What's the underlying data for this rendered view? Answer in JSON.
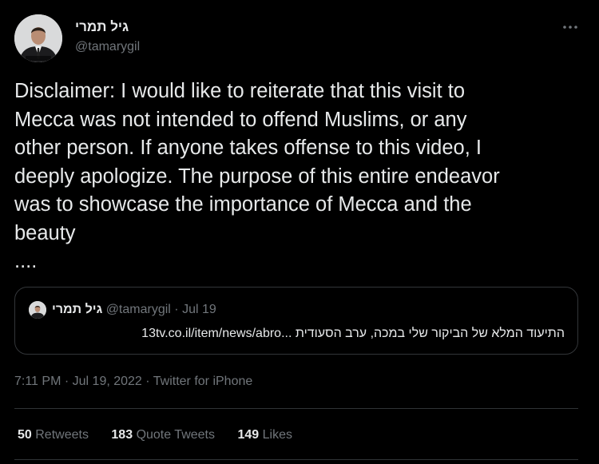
{
  "author": {
    "display_name": "גיל תמרי",
    "handle": "@tamarygil"
  },
  "tweet": {
    "text": "Disclaimer: I would like to reiterate that this visit to\nMecca was not intended to offend Muslims, or any\nother person. If anyone takes offense to this video, I\ndeeply apologize. The purpose of this entire endeavor\nwas to showcase the importance of Mecca and the\nbeauty\n...."
  },
  "quoted": {
    "display_name": "גיל תמרי",
    "handle": "@tamarygil",
    "separator": "·",
    "date": "Jul 19",
    "text_he": "התיעוד המלא של הביקור שלי במכה, ערב הסעודית",
    "url": "13tv.co.il/item/news/abro..."
  },
  "meta": {
    "time": "7:11 PM",
    "date": "Jul 19, 2022",
    "source": "Twitter for iPhone",
    "separator": "·"
  },
  "stats": {
    "retweets_count": "50",
    "retweets_label": "Retweets",
    "quotes_count": "183",
    "quotes_label": "Quote Tweets",
    "likes_count": "149",
    "likes_label": "Likes"
  },
  "icons": {
    "more": "more-horizontal-icon"
  },
  "colors": {
    "background": "#000000",
    "text_primary": "#e7e9ea",
    "text_secondary": "#71767b",
    "border": "#2f3336"
  }
}
